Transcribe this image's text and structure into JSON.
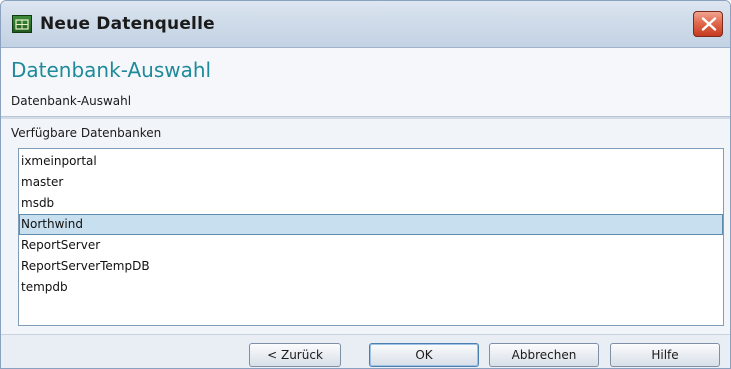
{
  "window": {
    "title": "Neue Datenquelle",
    "icon": "database-app-icon",
    "close_icon": "close-icon"
  },
  "header": {
    "heading": "Datenbank-Auswahl",
    "subheading": "Datenbank-Auswahl"
  },
  "content": {
    "list_label": "Verfügbare Datenbanken",
    "databases": [
      {
        "name": "ixmeinportal",
        "selected": false
      },
      {
        "name": "master",
        "selected": false
      },
      {
        "name": "msdb",
        "selected": false
      },
      {
        "name": "Northwind",
        "selected": true
      },
      {
        "name": "ReportServer",
        "selected": false
      },
      {
        "name": "ReportServerTempDB",
        "selected": false
      },
      {
        "name": "tempdb",
        "selected": false
      }
    ]
  },
  "buttons": {
    "back": "< Zurück",
    "ok": "OK",
    "cancel": "Abbrechen",
    "help": "Hilfe"
  },
  "colors": {
    "heading": "#1f8a9a",
    "selection": "#c7dfee",
    "close_button": "#d5543a"
  }
}
